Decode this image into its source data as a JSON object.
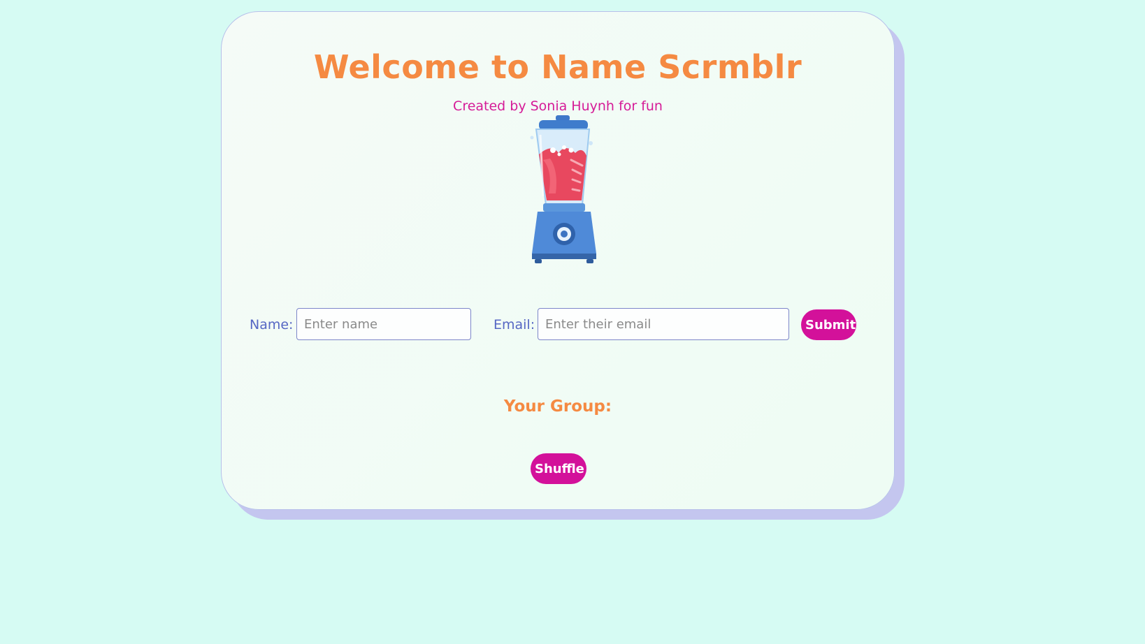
{
  "header": {
    "title": "Welcome to Name Scrmblr",
    "subtitle": "Created by Sonia Huynh for fun"
  },
  "hero": {
    "icon": "blender-icon"
  },
  "form": {
    "name_label": "Name:",
    "name_value": "",
    "name_placeholder": "Enter name",
    "email_label": "Email:",
    "email_value": "",
    "email_placeholder": "Enter their email",
    "submit_label": "Submit"
  },
  "group": {
    "heading": "Your Group:",
    "shuffle_label": "Shuffle"
  },
  "colors": {
    "page_background": "#d6fbf3",
    "title": "#f58a42",
    "accent": "#d3119a",
    "label": "#5667c4",
    "card_shadow": "#c4c6ef"
  }
}
